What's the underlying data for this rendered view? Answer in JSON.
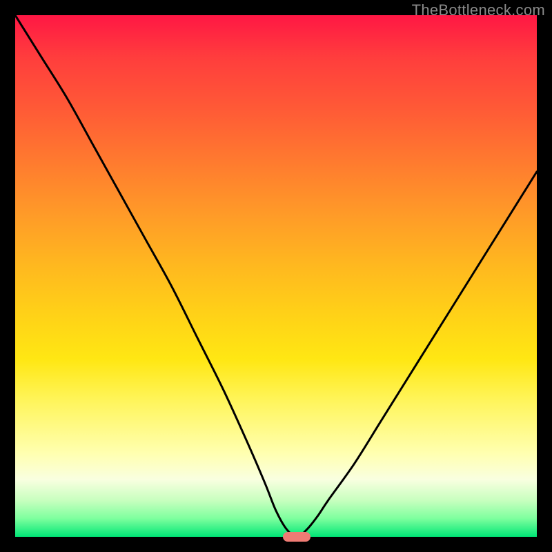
{
  "watermark": "TheBottleneck.com",
  "chart_data": {
    "type": "line",
    "title": "",
    "xlabel": "",
    "ylabel": "",
    "xlim": [
      0,
      100
    ],
    "ylim": [
      0,
      100
    ],
    "grid": false,
    "legend": false,
    "background": "rainbow-gradient-red-to-green",
    "series": [
      {
        "name": "bottleneck-curve",
        "x": [
          0,
          5,
          10,
          15,
          20,
          25,
          30,
          35,
          40,
          45,
          48,
          50,
          52,
          54,
          56,
          58,
          60,
          65,
          70,
          75,
          80,
          85,
          90,
          95,
          100
        ],
        "y": [
          100,
          92,
          84,
          75,
          66,
          57,
          48,
          38,
          28,
          17,
          10,
          5,
          1.5,
          0,
          1.5,
          4,
          7,
          14,
          22,
          30,
          38,
          46,
          54,
          62,
          70
        ]
      }
    ],
    "marker": {
      "x": 54,
      "y": 0,
      "color": "#ef7b74",
      "shape": "pill"
    },
    "colors": {
      "curve": "#000000",
      "frame": "#000000",
      "gradient_top": "#ff1744",
      "gradient_bottom": "#00e676"
    }
  }
}
